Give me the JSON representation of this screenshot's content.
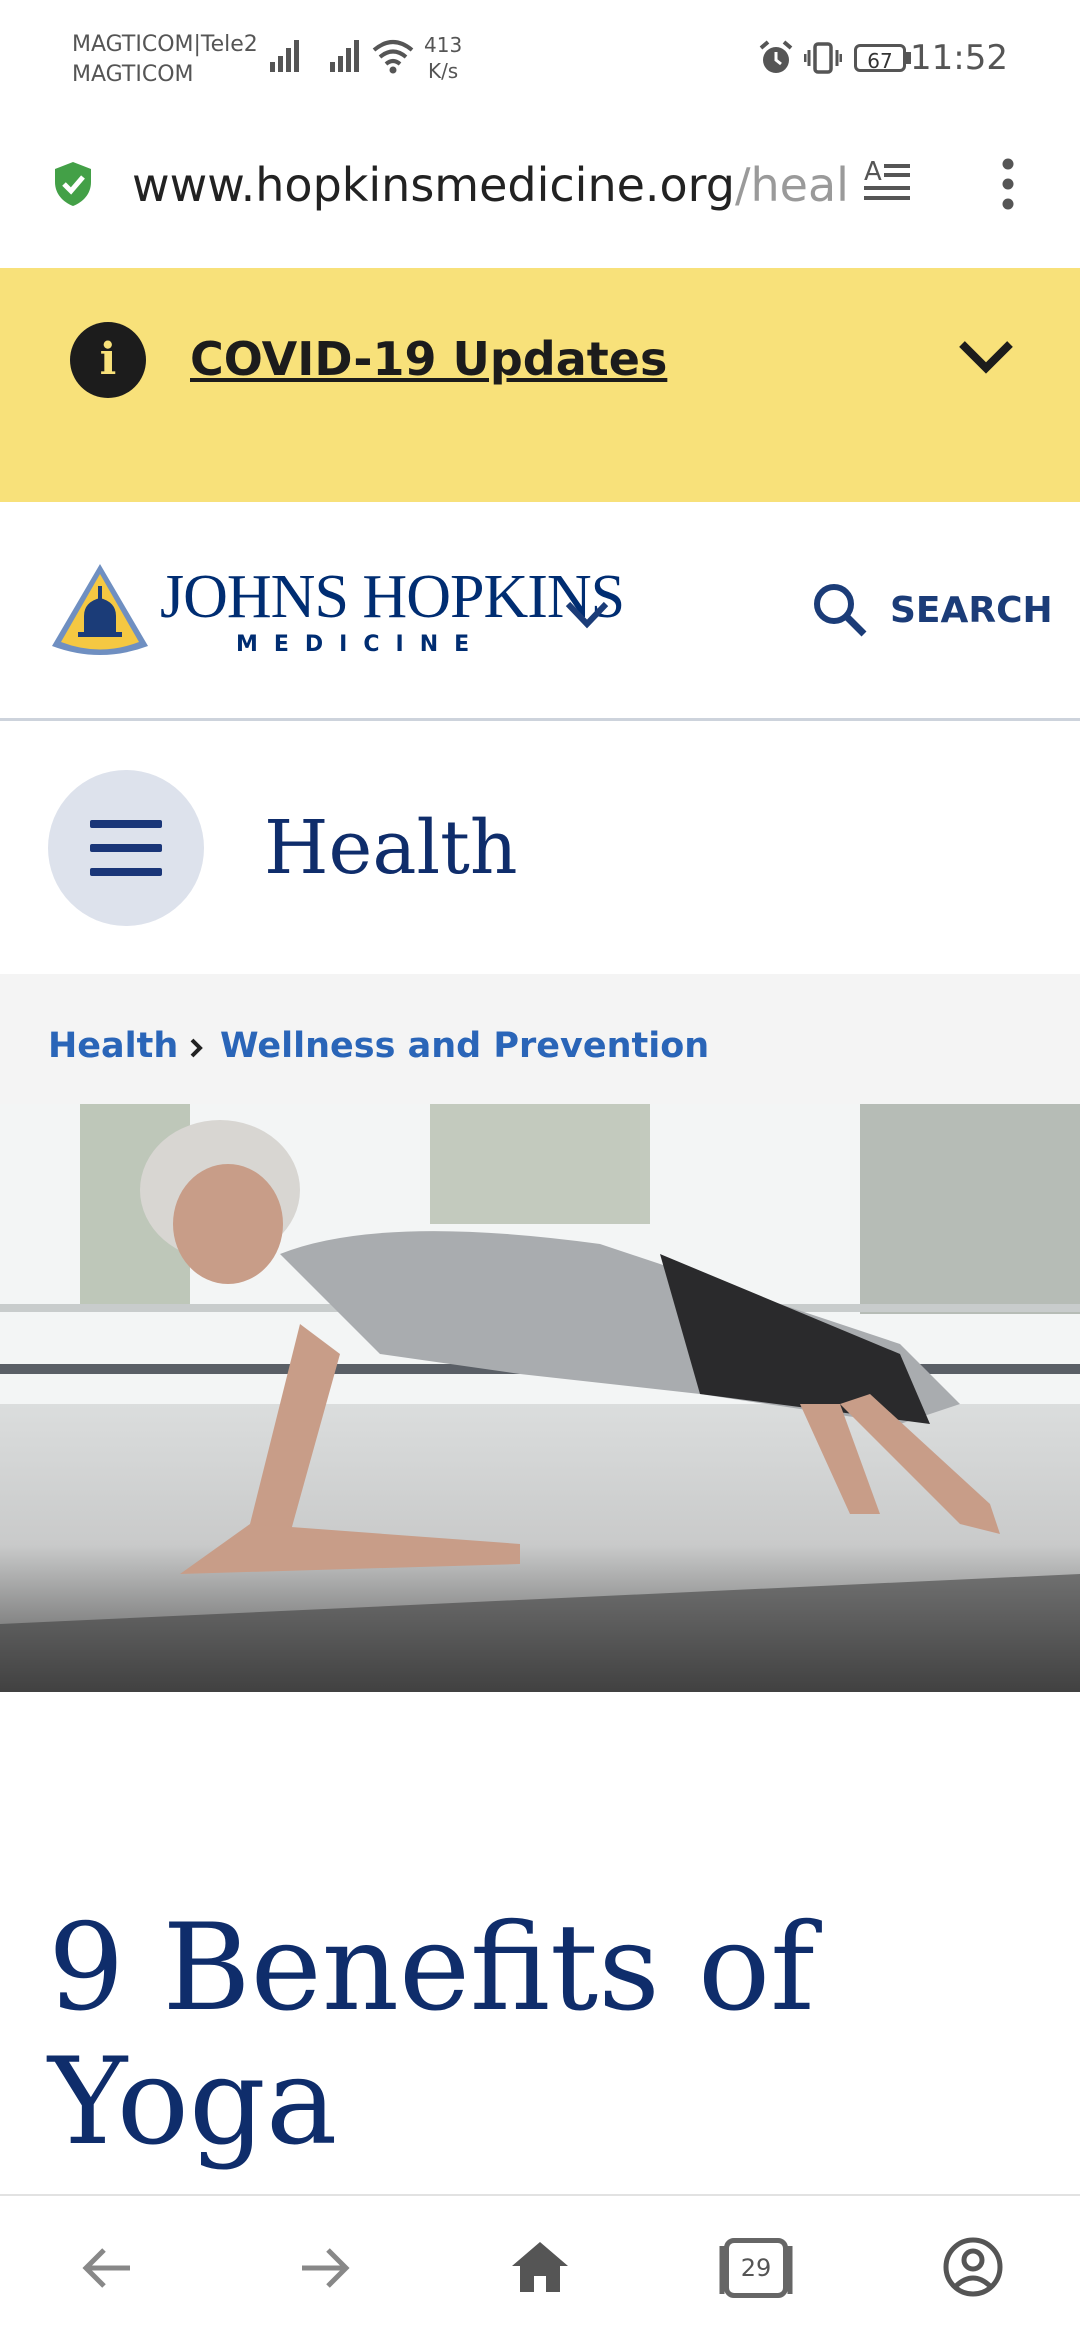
{
  "status_bar": {
    "carrier_line1": "MAGTICOM|Tele2",
    "carrier_line2": "MAGTICOM",
    "speed_value": "413",
    "speed_unit": "K/s",
    "battery": "67",
    "time": "11:52"
  },
  "browser": {
    "url_main": "www.hopkinsmedicine.org",
    "url_dim": "/heal",
    "tab_count": "29"
  },
  "banner": {
    "info_glyph": "i",
    "link_text": "COVID-19 Updates",
    "background": "#f8e17a"
  },
  "header": {
    "logo_title": "JOHNS HOPKINS",
    "logo_subtitle": "MEDICINE",
    "search_label": "SEARCH",
    "brand_color": "#002d72"
  },
  "section": {
    "title": "Health"
  },
  "breadcrumb": {
    "items": [
      "Health",
      "Wellness and Prevention"
    ],
    "link_color": "#2a65b8"
  },
  "hero": {
    "description": "Woman in plank pose on a yoga mat"
  },
  "article": {
    "title_line1": "9 Benefits of",
    "title_line2": "Yoga"
  },
  "icons": {
    "shield": "shield-check-icon",
    "reader": "reader-mode-icon",
    "more": "more-vert-icon",
    "chevron": "chevron-down-icon",
    "search": "search-icon",
    "menu": "hamburger-icon",
    "back": "arrow-back-icon",
    "forward": "arrow-forward-icon",
    "home": "home-icon",
    "tabs": "tabs-icon",
    "account": "account-icon"
  }
}
